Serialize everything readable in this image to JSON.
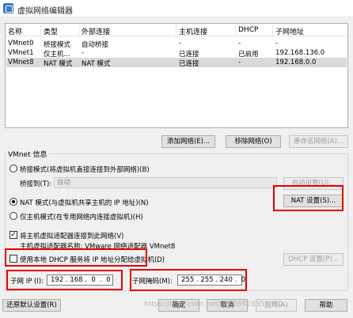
{
  "window": {
    "title": "虚拟网络编辑器"
  },
  "list": {
    "columns": [
      "名称",
      "类型",
      "外部连接",
      "主机连接",
      "DHCP",
      "子网地址"
    ],
    "rows": [
      [
        "VMnet0",
        "桥接模式",
        "自动桥接",
        "-",
        "-",
        "-"
      ],
      [
        "VMnet1",
        "仅主机...",
        "-",
        "已连接",
        "已启用",
        "192.168.136.0"
      ],
      [
        "VMnet8",
        "NAT 模式",
        "NAT 模式",
        "已连接",
        "-",
        "192.168.0.0"
      ]
    ],
    "selected_row": 2
  },
  "list_buttons": {
    "add": "添加网络(E)...",
    "remove": "移除网络(O)",
    "rename": "重命名网络(A)..."
  },
  "vmnet_info": {
    "group_title": "VMnet 信息",
    "bridged_radio": "桥接模式(将虚拟机直接连接到外部网络)(B)",
    "bridged_to_label": "桥接到(T):",
    "bridged_to_value": "自动",
    "auto_settings": "自动设置(U)...",
    "nat_radio": "NAT 模式(与虚拟机共享主机的 IP 地址)(N)",
    "nat_settings": "NAT 设置(S)...",
    "hostonly_radio": "仅主机模式(在专用网络内连接虚拟机)(H)",
    "selected_mode": "nat",
    "connect_adapter": "将主机虚拟适配器连接到此网络(V)",
    "connect_adapter_checked": true,
    "adapter_name": "主机虚拟适配器名称: VMware 网络适配器 VMnet8",
    "use_dhcp": "使用本地 DHCP 服务将 IP 地址分配给虚拟机(D)",
    "use_dhcp_checked": false,
    "dhcp_settings": "DHCP 设置(P)...",
    "subnet_ip_label": "子网 IP (I):",
    "subnet_ip_value": "192 . 168 .  0  .  0",
    "subnet_mask_label": "子网掩码(M):",
    "subnet_mask_value": "255 . 255 . 240 .  0"
  },
  "bottom_buttons": {
    "restore": "还原默认设置(R)",
    "ok": "确定",
    "cancel": "取消",
    "apply": "应用(A)",
    "help": "帮助"
  },
  "watermark": "https://blog.csdn.net/qq_28628355650"
}
